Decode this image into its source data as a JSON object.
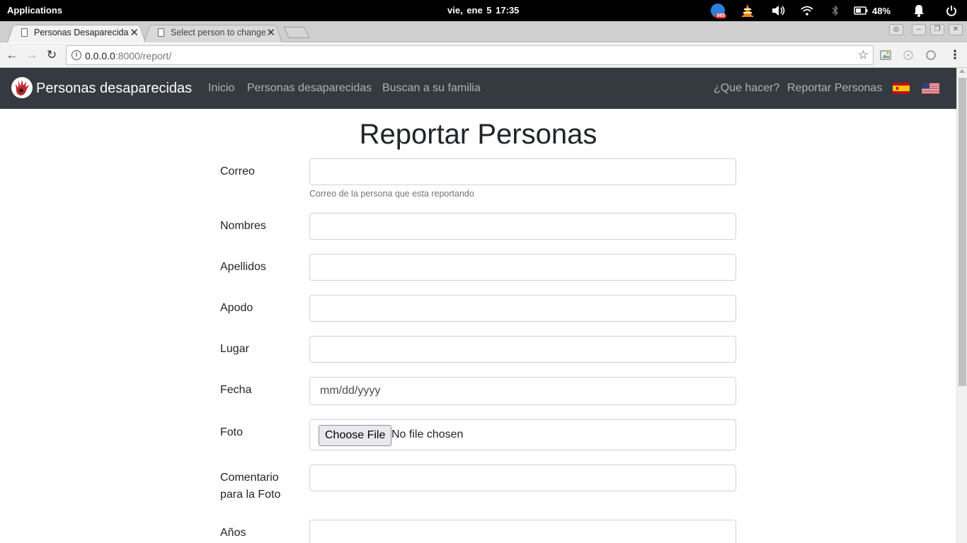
{
  "os_bar": {
    "applications": "Applications",
    "datetime": "vie, ene  5   17:35",
    "app_badge": "985",
    "battery": "48%"
  },
  "browser": {
    "tabs": [
      {
        "title": "Personas Desaparecidas",
        "active": true
      },
      {
        "title": "Select person to change",
        "active": false
      }
    ],
    "url_host": "0.0.0.0",
    "url_rest": ":8000/report/"
  },
  "site": {
    "brand": "Personas desaparecidas",
    "nav_left": [
      "Inicio",
      "Personas desaparecidas",
      "Buscan a su familia"
    ],
    "nav_right": [
      "¿Que hacer?",
      "Reportar Personas"
    ],
    "header_bg": "#343a40"
  },
  "form": {
    "title": "Reportar Personas",
    "correo_label": "Correo",
    "correo_help": "Correo de la persona que esta reportando",
    "nombres_label": "Nombres",
    "apellidos_label": "Apellidos",
    "apodo_label": "Apodo",
    "lugar_label": "Lugar",
    "fecha_label": "Fecha",
    "fecha_placeholder": "mm/dd/yyyy",
    "foto_label": "Foto",
    "file_button": "Choose File",
    "file_status": "No file chosen",
    "comentario_label_1": "Comentario",
    "comentario_label_2": "para la Foto",
    "anos_label": "Años"
  }
}
